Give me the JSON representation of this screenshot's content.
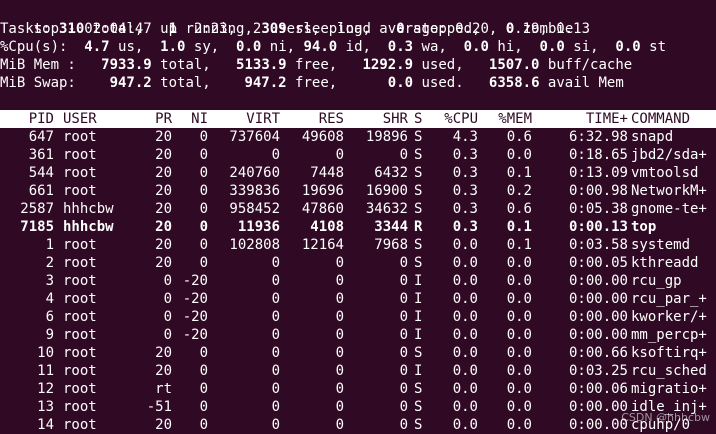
{
  "summary": {
    "line1": {
      "prefix": "top - 02:04:47 up  2:23,  2 users,  load average: 0.20, 0.19, 0.13"
    },
    "line2": {
      "label": "Tasks: ",
      "total": "310",
      "total_label": " total,   ",
      "running": "1",
      "running_label": " running, ",
      "sleeping": "309",
      "sleeping_label": " sleeping,   ",
      "stopped": "0",
      "stopped_label": " stopped,   ",
      "zombie": "0",
      "zombie_label": " zombie"
    },
    "line3": {
      "label": "%Cpu(s):  ",
      "us": "4.7",
      "us_label": " us,  ",
      "sy": "1.0",
      "sy_label": " sy,  ",
      "ni": "0.0",
      "ni_label": " ni, ",
      "id": "94.0",
      "id_label": " id,  ",
      "wa": "0.3",
      "wa_label": " wa,  ",
      "hi": "0.0",
      "hi_label": " hi,  ",
      "si": "0.0",
      "si_label": " si,  ",
      "st": "0.0",
      "st_label": " st"
    },
    "line4": {
      "label": "MiB Mem :   ",
      "total": "7933.9",
      "total_label": " total,   ",
      "free": "5133.9",
      "free_label": " free,   ",
      "used": "1292.9",
      "used_label": " used,   ",
      "buff": "1507.0",
      "buff_label": " buff/cache"
    },
    "line5": {
      "label": "MiB Swap:    ",
      "total": "947.2",
      "total_label": " total,    ",
      "free": "947.2",
      "free_label": " free,      ",
      "used": "0.0",
      "used_label": " used.   ",
      "avail": "6358.6",
      "avail_label": " avail Mem"
    }
  },
  "columns": [
    "PID",
    "USER",
    "PR",
    "NI",
    "VIRT",
    "RES",
    "SHR",
    "S",
    "%CPU",
    "%MEM",
    "TIME+",
    "COMMAND"
  ],
  "processes": [
    {
      "pid": "647",
      "user": "root",
      "pr": "20",
      "ni": "0",
      "virt": "737604",
      "res": "49608",
      "shr": "19896",
      "s": "S",
      "cpu": "4.3",
      "mem": "0.6",
      "time": "6:32.98",
      "cmd": "snapd",
      "bold": false
    },
    {
      "pid": "361",
      "user": "root",
      "pr": "20",
      "ni": "0",
      "virt": "0",
      "res": "0",
      "shr": "0",
      "s": "S",
      "cpu": "0.3",
      "mem": "0.0",
      "time": "0:18.65",
      "cmd": "jbd2/sda+",
      "bold": false
    },
    {
      "pid": "544",
      "user": "root",
      "pr": "20",
      "ni": "0",
      "virt": "240760",
      "res": "7448",
      "shr": "6432",
      "s": "S",
      "cpu": "0.3",
      "mem": "0.1",
      "time": "0:13.09",
      "cmd": "vmtoolsd",
      "bold": false
    },
    {
      "pid": "661",
      "user": "root",
      "pr": "20",
      "ni": "0",
      "virt": "339836",
      "res": "19696",
      "shr": "16900",
      "s": "S",
      "cpu": "0.3",
      "mem": "0.2",
      "time": "0:00.98",
      "cmd": "NetworkM+",
      "bold": false
    },
    {
      "pid": "2587",
      "user": "hhhcbw",
      "pr": "20",
      "ni": "0",
      "virt": "958452",
      "res": "47860",
      "shr": "34632",
      "s": "S",
      "cpu": "0.3",
      "mem": "0.6",
      "time": "0:05.38",
      "cmd": "gnome-te+",
      "bold": false
    },
    {
      "pid": "7185",
      "user": "hhhcbw",
      "pr": "20",
      "ni": "0",
      "virt": "11936",
      "res": "4108",
      "shr": "3344",
      "s": "R",
      "cpu": "0.3",
      "mem": "0.1",
      "time": "0:00.13",
      "cmd": "top",
      "bold": true
    },
    {
      "pid": "1",
      "user": "root",
      "pr": "20",
      "ni": "0",
      "virt": "102808",
      "res": "12164",
      "shr": "7968",
      "s": "S",
      "cpu": "0.0",
      "mem": "0.1",
      "time": "0:03.58",
      "cmd": "systemd",
      "bold": false
    },
    {
      "pid": "2",
      "user": "root",
      "pr": "20",
      "ni": "0",
      "virt": "0",
      "res": "0",
      "shr": "0",
      "s": "S",
      "cpu": "0.0",
      "mem": "0.0",
      "time": "0:00.05",
      "cmd": "kthreadd",
      "bold": false
    },
    {
      "pid": "3",
      "user": "root",
      "pr": "0",
      "ni": "-20",
      "virt": "0",
      "res": "0",
      "shr": "0",
      "s": "I",
      "cpu": "0.0",
      "mem": "0.0",
      "time": "0:00.00",
      "cmd": "rcu_gp",
      "bold": false
    },
    {
      "pid": "4",
      "user": "root",
      "pr": "0",
      "ni": "-20",
      "virt": "0",
      "res": "0",
      "shr": "0",
      "s": "I",
      "cpu": "0.0",
      "mem": "0.0",
      "time": "0:00.00",
      "cmd": "rcu_par_+",
      "bold": false
    },
    {
      "pid": "6",
      "user": "root",
      "pr": "0",
      "ni": "-20",
      "virt": "0",
      "res": "0",
      "shr": "0",
      "s": "I",
      "cpu": "0.0",
      "mem": "0.0",
      "time": "0:00.00",
      "cmd": "kworker/+",
      "bold": false
    },
    {
      "pid": "9",
      "user": "root",
      "pr": "0",
      "ni": "-20",
      "virt": "0",
      "res": "0",
      "shr": "0",
      "s": "I",
      "cpu": "0.0",
      "mem": "0.0",
      "time": "0:00.00",
      "cmd": "mm_percp+",
      "bold": false
    },
    {
      "pid": "10",
      "user": "root",
      "pr": "20",
      "ni": "0",
      "virt": "0",
      "res": "0",
      "shr": "0",
      "s": "S",
      "cpu": "0.0",
      "mem": "0.0",
      "time": "0:00.66",
      "cmd": "ksoftirq+",
      "bold": false
    },
    {
      "pid": "11",
      "user": "root",
      "pr": "20",
      "ni": "0",
      "virt": "0",
      "res": "0",
      "shr": "0",
      "s": "I",
      "cpu": "0.0",
      "mem": "0.0",
      "time": "0:03.25",
      "cmd": "rcu_sched",
      "bold": false
    },
    {
      "pid": "12",
      "user": "root",
      "pr": "rt",
      "ni": "0",
      "virt": "0",
      "res": "0",
      "shr": "0",
      "s": "S",
      "cpu": "0.0",
      "mem": "0.0",
      "time": "0:00.06",
      "cmd": "migratio+",
      "bold": false
    },
    {
      "pid": "13",
      "user": "root",
      "pr": "-51",
      "ni": "0",
      "virt": "0",
      "res": "0",
      "shr": "0",
      "s": "S",
      "cpu": "0.0",
      "mem": "0.0",
      "time": "0:00.00",
      "cmd": "idle_inj+",
      "bold": false
    },
    {
      "pid": "14",
      "user": "root",
      "pr": "20",
      "ni": "0",
      "virt": "0",
      "res": "0",
      "shr": "0",
      "s": "S",
      "cpu": "0.0",
      "mem": "0.0",
      "time": "0:00.00",
      "cmd": "cpuhp/0",
      "bold": false
    }
  ],
  "watermark": "CSDN @hhhcbw",
  "colors": {
    "background": "#300a24",
    "foreground": "#ffffff"
  }
}
